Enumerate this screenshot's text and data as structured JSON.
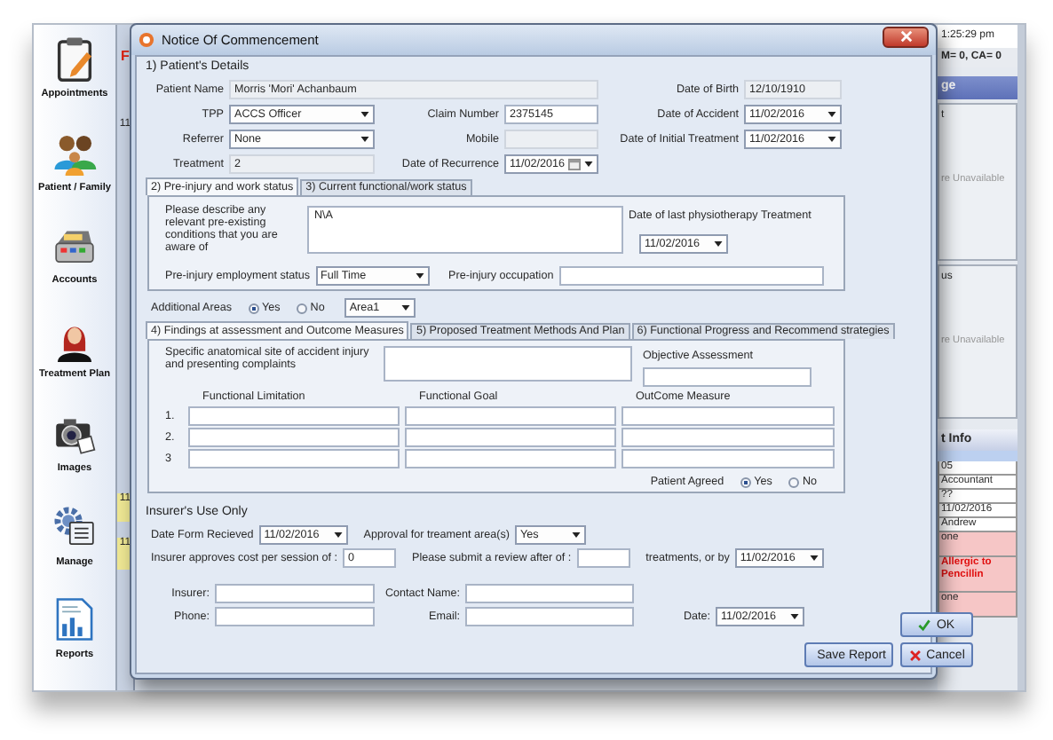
{
  "sidebar": {
    "items": [
      {
        "label": "Appointments",
        "kind": "clipboard"
      },
      {
        "label": "Patient / Family",
        "kind": "people"
      },
      {
        "label": "Accounts",
        "kind": "register"
      },
      {
        "label": "Treatment Plan",
        "kind": "person"
      },
      {
        "label": "Images",
        "kind": "camera"
      },
      {
        "label": "Manage",
        "kind": "gear"
      },
      {
        "label": "Reports",
        "kind": "report"
      }
    ]
  },
  "left_strip": [
    {
      "text": "F",
      "kind": "red"
    },
    {
      "text": "11",
      "kind": "plain"
    },
    {
      "text": "11",
      "kind": "yellow"
    },
    {
      "text": "11",
      "kind": "yellow"
    }
  ],
  "background_window": {
    "clock": "1:25:29 pm",
    "counts": "M= 0, CA= 0",
    "panel_heading": "ge",
    "panels": [
      {
        "title": "t",
        "message": "re Unavailable"
      },
      {
        "title": "us",
        "message": "re Unavailable"
      }
    ],
    "info_heading": "t Info",
    "info_rows": [
      {
        "text": "05",
        "kind": "plain"
      },
      {
        "text": "Accountant",
        "kind": "plain"
      },
      {
        "text": "??",
        "kind": "plain"
      },
      {
        "text": "11/02/2016",
        "kind": "plain"
      },
      {
        "text": "Andrew",
        "kind": "plain"
      },
      {
        "text": "one",
        "kind": "pink"
      },
      {
        "text": "Allergic to Pencillin",
        "kind": "allergy"
      },
      {
        "text": "one",
        "kind": "pink"
      }
    ]
  },
  "dialog": {
    "title": "Notice Of Commencement",
    "patient_details": {
      "heading": "1) Patient's  Details",
      "patient_name": {
        "label": "Patient Name",
        "value": "Morris 'Mori' Achanbaum",
        "kind": "readonly_wide"
      },
      "date_of_birth": {
        "label": "Date of Birth",
        "value": "12/10/1910",
        "kind": "readonly"
      },
      "tpp": {
        "label": "TPP",
        "value": "ACCS Officer",
        "kind": "combo"
      },
      "claim_number": {
        "label": "Claim Number",
        "value": "2375145",
        "kind": "text"
      },
      "date_of_accident": {
        "label": "Date of Accident",
        "value": "11/02/2016",
        "kind": "combo"
      },
      "referrer": {
        "label": "Referrer",
        "value": "None",
        "kind": "combo"
      },
      "mobile": {
        "label": "Mobile",
        "kind": "readonly"
      },
      "date_of_initial_treatment": {
        "label": "Date of Initial Treatment",
        "value": "11/02/2016",
        "kind": "combo"
      },
      "treatment": {
        "label": "Treatment",
        "value": "2",
        "kind": "readonly"
      },
      "date_of_recurrence": {
        "label": "Date of Recurrence",
        "value": "11/02/2016",
        "kind": "date"
      }
    },
    "status_tabs": {
      "tabs": [
        {
          "label": "2) Pre-injury and work status",
          "selected": true
        },
        {
          "label": "3) Current functional/work status",
          "selected": false
        }
      ],
      "conditions": {
        "label": "Please describe any relevant pre-existing conditions that you are aware of",
        "value": "N\\A"
      },
      "last_physio": {
        "label": "Date of last physiotherapy Treatment",
        "value": "11/02/2016",
        "kind": "combo"
      },
      "employment_status": {
        "label": "Pre-injury employment status",
        "value": "Full Time",
        "kind": "combo"
      },
      "occupation": {
        "label": "Pre-injury occupation",
        "kind": "text"
      }
    },
    "additional_areas": {
      "label": "Additional Areas",
      "options": [
        {
          "label": "Yes",
          "selected": true
        },
        {
          "label": "No",
          "selected": false
        }
      ],
      "area": {
        "value": "Area1",
        "kind": "combo"
      }
    },
    "findings_tabs": {
      "tabs": [
        {
          "label": "4) Findings at assessment and Outcome Measures",
          "selected": true
        },
        {
          "label": "5) Proposed Treatment Methods And Plan",
          "selected": false
        },
        {
          "label": "6) Functional Progress and Recommend strategies",
          "selected": false
        }
      ],
      "anatomical_site": {
        "label": "Specific anatomical site of accident injury and presenting complaints"
      },
      "objective_assessment": {
        "label": "Objective Assessment"
      },
      "columns": [
        "Functional Limitation",
        "Functional Goal",
        "OutCome Measure"
      ],
      "rows": [
        {
          "number": "1."
        },
        {
          "number": "2."
        },
        {
          "number": "3"
        }
      ],
      "patient_agreed": {
        "label": "Patient Agreed",
        "options": [
          {
            "label": "Yes",
            "selected": true
          },
          {
            "label": "No",
            "selected": false
          }
        ]
      }
    },
    "insurer": {
      "heading": "Insurer's  Use Only",
      "date_form_received": {
        "label": "Date Form Recieved",
        "value": "11/02/2016",
        "kind": "combo"
      },
      "approval": {
        "label": "Approval for treament area(s)",
        "value": "Yes",
        "kind": "combo"
      },
      "cost": {
        "label": "Insurer approves cost per session of :",
        "value": "0",
        "kind": "text"
      },
      "review": {
        "label": "Please submit a review after of :",
        "kind": "text"
      },
      "treatments_by": {
        "label": "treatments, or by",
        "value": "11/02/2016",
        "kind": "combo"
      },
      "insurer_name": {
        "label": "Insurer:",
        "kind": "text"
      },
      "contact_name": {
        "label": "Contact Name:",
        "kind": "text"
      },
      "phone": {
        "label": "Phone:",
        "kind": "text"
      },
      "email": {
        "label": "Email:",
        "kind": "text"
      },
      "date": {
        "label": "Date:",
        "value": "11/02/2016",
        "kind": "combo"
      }
    },
    "buttons": [
      {
        "label": "OK",
        "kind": "ok"
      },
      {
        "label": "Save Report",
        "kind": "save"
      },
      {
        "label": "Cancel",
        "kind": "cancel"
      }
    ]
  }
}
